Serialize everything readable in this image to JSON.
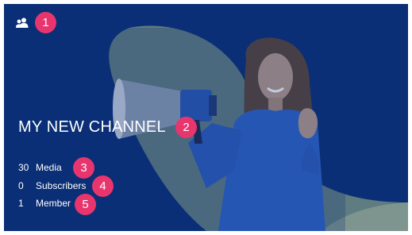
{
  "header": {
    "icon": "people-group-icon"
  },
  "channel": {
    "title": "MY NEW CHANNEL"
  },
  "stats": [
    {
      "count": "30",
      "label": "Media"
    },
    {
      "count": "0",
      "label": "Subscribers"
    },
    {
      "count": "1",
      "label": "Member"
    }
  ],
  "badges": [
    "1",
    "2",
    "3",
    "4",
    "5"
  ],
  "colors": {
    "background": "#0a2f76",
    "badge": "#e8356d",
    "swoosh": "#9fb3a6",
    "shirt": "#2f63c8"
  }
}
